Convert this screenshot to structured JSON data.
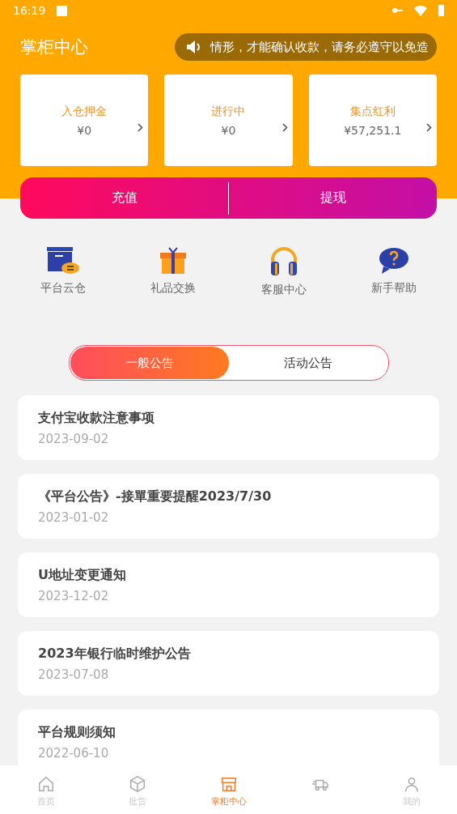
{
  "status_bar": {
    "time": "16:19"
  },
  "header": {
    "title": "掌柜中心",
    "notice": "情形，才能确认收款，请务必遵守以免造"
  },
  "stats": [
    {
      "label": "入仓押金",
      "value": "¥0"
    },
    {
      "label": "进行中",
      "value": "¥0"
    },
    {
      "label": "集点红利",
      "value": "¥57,251.1"
    }
  ],
  "actions": [
    "充值",
    "提现"
  ],
  "shortcuts": [
    {
      "kind": "warehouse",
      "label": "平台云仓"
    },
    {
      "kind": "gift",
      "label": "礼品交换"
    },
    {
      "kind": "headset",
      "label": "客服中心"
    },
    {
      "kind": "help",
      "label": "新手帮助"
    }
  ],
  "tabs": [
    {
      "label": "一般公告",
      "selected": true
    },
    {
      "label": "活动公告",
      "selected": false
    }
  ],
  "notices": [
    {
      "title": "支付宝收款注意事项",
      "date": "2023-09-02"
    },
    {
      "title": "《平台公告》-接單重要提醒2023/7/30",
      "date": "2023-01-02"
    },
    {
      "title": "U地址变更通知",
      "date": "2023-12-02"
    },
    {
      "title": "2023年银行临时维护公告",
      "date": "2023-07-08"
    },
    {
      "title": "平台规则须知",
      "date": "2022-06-10"
    }
  ],
  "bottom_nav": [
    {
      "kind": "home",
      "label": "首页",
      "selected": false
    },
    {
      "kind": "box",
      "label": "批货",
      "selected": false
    },
    {
      "kind": "store",
      "label": "掌柜中心",
      "selected": true
    },
    {
      "kind": "truck",
      "selected": false
    },
    {
      "kind": "user",
      "label": "我的",
      "selected": false
    }
  ]
}
